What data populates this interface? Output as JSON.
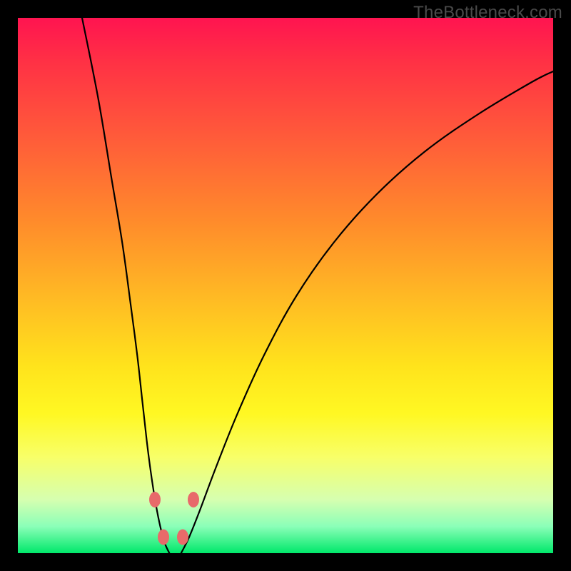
{
  "watermark": "TheBottleneck.com",
  "colors": {
    "frame_border": "#000000",
    "curve": "#000000",
    "dot": "#e86a6a",
    "gradient_top": "#ff1450",
    "gradient_bottom": "#00e86a"
  },
  "chart_data": {
    "type": "line",
    "title": "",
    "xlabel": "",
    "ylabel": "",
    "xlim": [
      0,
      100
    ],
    "ylim": [
      0,
      100
    ],
    "grid": false,
    "legend": false,
    "note": "Axes unlabeled; values are relative 0–100 plot-coordinate estimates read from the image. Y increases upward (top of gradient ≈ 100).",
    "series": [
      {
        "name": "left-branch",
        "x": [
          12.0,
          15.0,
          17.5,
          19.5,
          21.0,
          22.3,
          23.3,
          24.2,
          25.0,
          25.8,
          26.6,
          27.4,
          28.3
        ],
        "y": [
          100.0,
          85.0,
          70.0,
          58.0,
          47.0,
          37.0,
          28.0,
          20.0,
          14.0,
          9.0,
          5.0,
          2.0,
          0.0
        ]
      },
      {
        "name": "right-branch",
        "x": [
          30.5,
          32.0,
          34.0,
          37.0,
          41.0,
          46.0,
          52.0,
          59.0,
          67.0,
          76.0,
          86.0,
          96.0,
          100.0
        ],
        "y": [
          0.0,
          3.0,
          8.0,
          16.0,
          26.0,
          37.0,
          48.0,
          58.0,
          67.0,
          75.0,
          82.0,
          88.0,
          90.0
        ]
      }
    ],
    "markers": [
      {
        "name": "left-upper-dot",
        "x": 25.6,
        "y": 10.0
      },
      {
        "name": "left-lower-dot",
        "x": 27.2,
        "y": 3.0
      },
      {
        "name": "right-lower-dot",
        "x": 30.8,
        "y": 3.0
      },
      {
        "name": "right-upper-dot",
        "x": 32.8,
        "y": 10.0
      }
    ]
  }
}
